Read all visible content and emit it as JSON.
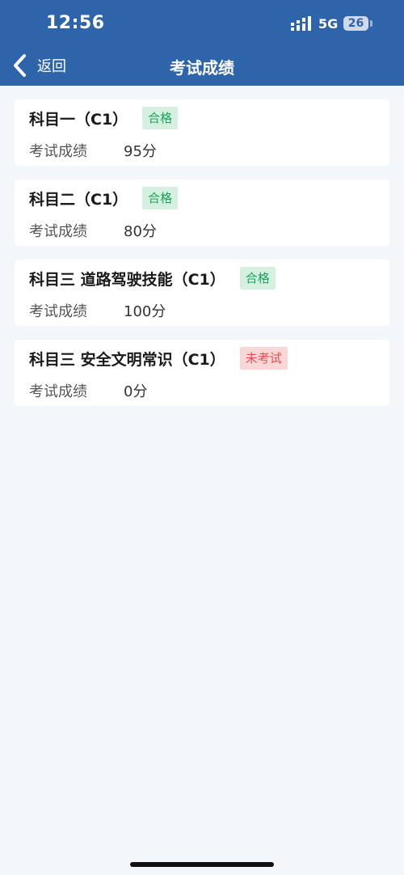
{
  "status_bar": {
    "time": "12:56",
    "network": "5G",
    "battery": "26"
  },
  "nav": {
    "back_label": "返回",
    "title": "考试成绩"
  },
  "colors": {
    "header_bg": "#2e64a9",
    "pass_bg": "#d5efe0",
    "pass_text": "#1aa35b",
    "fail_bg": "#fbd6d6",
    "fail_text": "#e0504f",
    "page_bg": "#f4f7f9"
  },
  "icons": {
    "back": "chevron-left-icon",
    "signal": "signal-bars-icon",
    "battery": "battery-icon"
  },
  "exams": [
    {
      "name": "科目一（C1）",
      "status": "合格",
      "status_type": "pass",
      "score_label": "考试成绩",
      "score": "95分"
    },
    {
      "name": "科目二（C1）",
      "status": "合格",
      "status_type": "pass",
      "score_label": "考试成绩",
      "score": "80分"
    },
    {
      "name": "科目三 道路驾驶技能（C1）",
      "status": "合格",
      "status_type": "pass",
      "score_label": "考试成绩",
      "score": "100分"
    },
    {
      "name": "科目三 安全文明常识（C1）",
      "status": "未考试",
      "status_type": "fail",
      "score_label": "考试成绩",
      "score": "0分"
    }
  ]
}
